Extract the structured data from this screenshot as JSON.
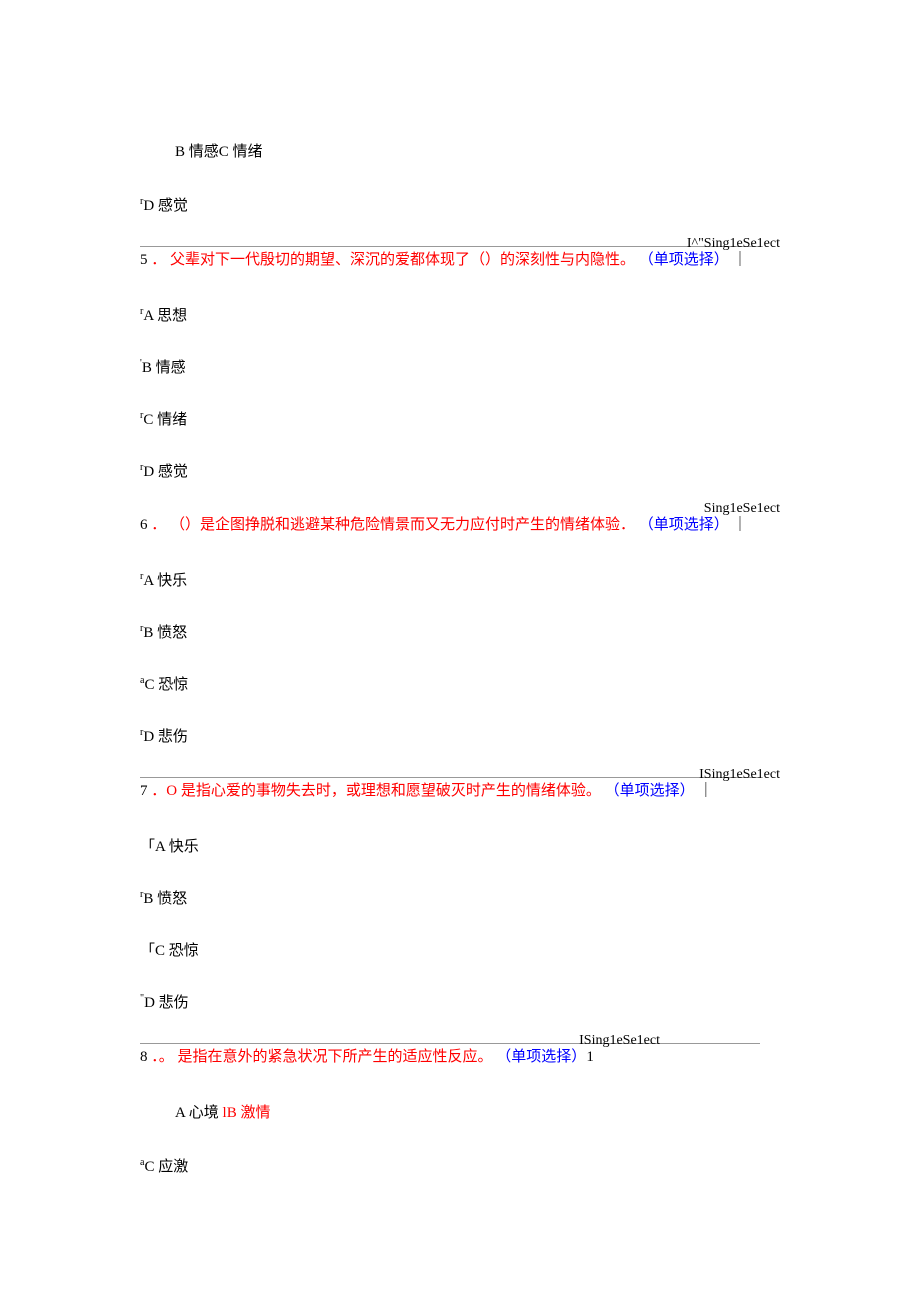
{
  "q4_partial": {
    "opt_bc": "B 情感C 情绪",
    "opt_d_prefix": "r",
    "opt_d": "D 感觉"
  },
  "q5": {
    "tag": "I^\"Sing1eSe1ect",
    "number": "5",
    "dot": "．",
    "stem": "父辈对下一代殷切的期望、深沉的爱都体现了（）的深刻性与内隐性。",
    "type_label": "（单项选择）",
    "bar": "｜",
    "opts": {
      "a_prefix": "r",
      "a": "A 思想",
      "b_prefix": "'",
      "b": "B 情感",
      "c_prefix": "r",
      "c": "C 情绪",
      "d_prefix": "r",
      "d": "D 感觉"
    }
  },
  "q6": {
    "tag": "Sing1eSe1ect",
    "number": "6",
    "dot": "．",
    "stem": "（）是企图挣脱和逃避某种危险情景而又无力应付时产生的情绪体验．",
    "type_label": "（单项选择）",
    "bar": "｜",
    "opts": {
      "a_prefix": "r",
      "a": "A 快乐",
      "b_prefix": "r",
      "b": "B 愤怒",
      "c_prefix": "a",
      "c": "C 恐惊",
      "d_prefix": "r",
      "d": "D 悲伤"
    }
  },
  "q7": {
    "tag": "ISing1eSe1ect",
    "number": "7",
    "dot": "．",
    "stem_prefix": "O",
    "stem": "是指心爱的事物失去时，或理想和愿望破灭时产生的情绪体验。",
    "type_label": "（单项选择）",
    "bar": "｜",
    "opts": {
      "a_prefix": "「",
      "a": "A 快乐",
      "b_prefix": "r",
      "b": "B 愤怒",
      "c_prefix": "「",
      "c": "C 恐惊",
      "d_prefix": "\"",
      "d": "D 悲伤"
    }
  },
  "q8": {
    "tag": "ISing1eSe1ect",
    "number": "8",
    "dot": "．",
    "stem_prefix": "。",
    "stem": "是指在意外的紧急状况下所产生的适应性反应。",
    "type_label": "（单项选择）",
    "suffix": "1",
    "opt_ab_a": "A 心境",
    "opt_ab_sep": " l",
    "opt_ab_b": "B 激情",
    "opt_c_prefix": "a",
    "opt_c": "C 应激"
  }
}
